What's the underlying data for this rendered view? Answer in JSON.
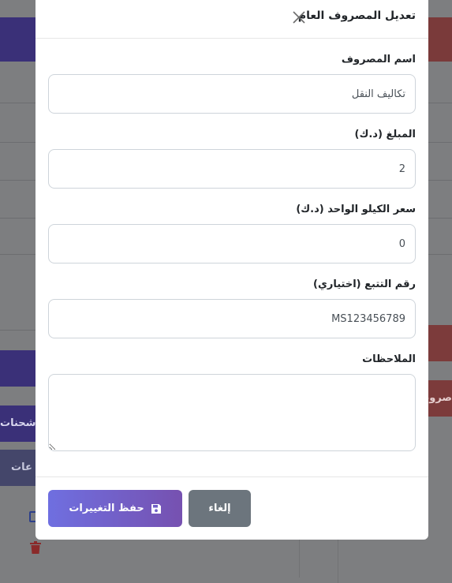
{
  "modal": {
    "title": "تعديل المصروف العام",
    "fields": [
      {
        "label": "اسم المصروف",
        "value": "تكاليف النقل"
      },
      {
        "label": "المبلغ (د.ك)",
        "value": "2"
      },
      {
        "label": "سعر الكيلو الواحد (د.ك)",
        "value": "0"
      },
      {
        "label": "رقم التتبع (اختياري)",
        "value": "MS123456789"
      },
      {
        "label": "الملاحظات",
        "value": ""
      }
    ],
    "buttons": {
      "cancel_label": "إلغاء",
      "save_label": "حفظ التغييرات"
    }
  },
  "background": {
    "left_button_1": "شحنات",
    "left_button_2": "عات",
    "right_button": "صروف"
  },
  "icons": {
    "close": "close-icon",
    "save": "floppy-disk-icon",
    "edit": "edit-icon",
    "trash": "trash-icon"
  },
  "colors": {
    "cancel_bg": "#6c757d",
    "save_gradient_start": "#6f6fe0",
    "save_gradient_end": "#7651b0",
    "backdrop": "#7d7e80"
  }
}
